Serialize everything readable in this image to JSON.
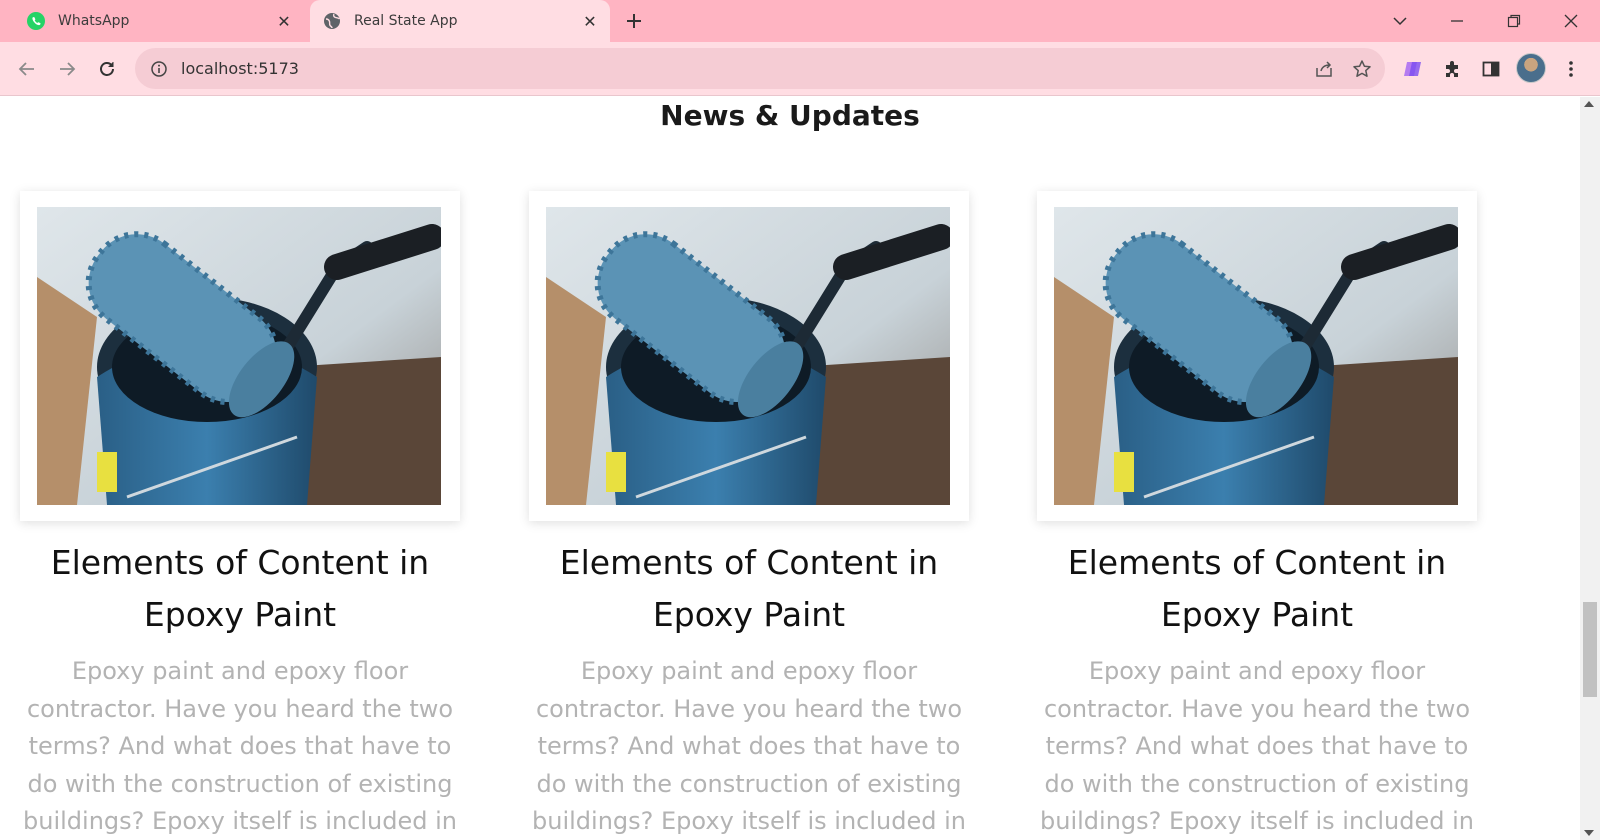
{
  "browser": {
    "tabs": [
      {
        "title": "WhatsApp",
        "icon": "whatsapp-icon",
        "active": false
      },
      {
        "title": "Real State App",
        "icon": "globe-icon",
        "active": true
      }
    ],
    "new_tab_icon": "plus-icon",
    "address": "localhost:5173",
    "colors": {
      "tabstrip": "#ffb4c2",
      "toolbar": "#ffdde3",
      "omnibox": "#f5ccd4"
    }
  },
  "page": {
    "section_title": "News & Updates",
    "cards": [
      {
        "heading": "Elements of Content in Epoxy Paint",
        "description": "Epoxy paint and epoxy floor contractor. Have you heard the two terms? And what does that have to do with the construction of existing buildings? Epoxy itself is included in"
      },
      {
        "heading": "Elements of Content in Epoxy Paint",
        "description": "Epoxy paint and epoxy floor contractor. Have you heard the two terms? And what does that have to do with the construction of existing buildings? Epoxy itself is included in"
      },
      {
        "heading": "Elements of Content in Epoxy Paint",
        "description": "Epoxy paint and epoxy floor contractor. Have you heard the two terms? And what does that have to do with the construction of existing buildings? Epoxy itself is included in"
      }
    ],
    "colors": {
      "heading": "#111111",
      "description": "#b3b3b3"
    }
  }
}
